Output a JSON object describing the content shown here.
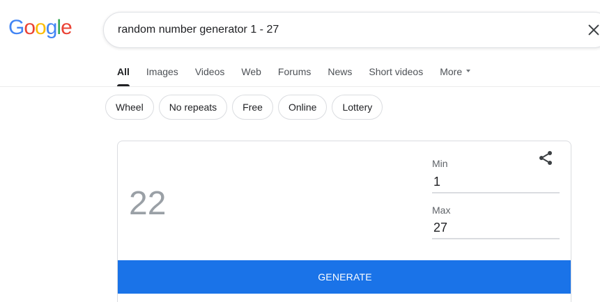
{
  "logo": {
    "letters": [
      {
        "char": "G",
        "color": "#4285F4"
      },
      {
        "char": "o",
        "color": "#EA4335"
      },
      {
        "char": "o",
        "color": "#FBBC05"
      },
      {
        "char": "g",
        "color": "#4285F4"
      },
      {
        "char": "l",
        "color": "#34A853"
      },
      {
        "char": "e",
        "color": "#EA4335"
      }
    ]
  },
  "search": {
    "query": "random number generator 1 - 27",
    "clear_icon": "close-icon"
  },
  "tabs": [
    {
      "label": "All",
      "active": true
    },
    {
      "label": "Images"
    },
    {
      "label": "Videos"
    },
    {
      "label": "Web"
    },
    {
      "label": "Forums"
    },
    {
      "label": "News"
    },
    {
      "label": "Short videos"
    },
    {
      "label": "More",
      "has_caret": true
    }
  ],
  "chips": [
    "Wheel",
    "No repeats",
    "Free",
    "Online",
    "Lottery"
  ],
  "generator": {
    "result": "22",
    "min_label": "Min",
    "min_value": "1",
    "max_label": "Max",
    "max_value": "27",
    "button_label": "GENERATE",
    "share_icon": "share-icon",
    "accent_color": "#1a73e8"
  }
}
